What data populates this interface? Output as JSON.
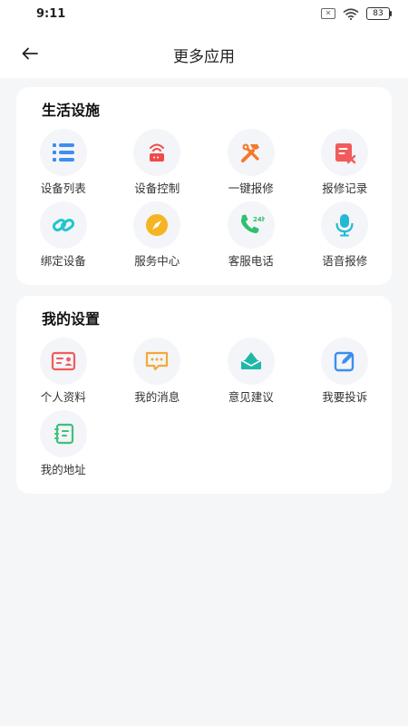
{
  "status": {
    "time": "9:11",
    "battery": "83"
  },
  "nav": {
    "title": "更多应用"
  },
  "sections": [
    {
      "title": "生活设施",
      "items": [
        {
          "label": "设备列表",
          "icon": "list-icon",
          "color": "#3d8ef0"
        },
        {
          "label": "设备控制",
          "icon": "router-icon",
          "color": "#f04a4a"
        },
        {
          "label": "一键报修",
          "icon": "tools-icon",
          "color": "#f5792a"
        },
        {
          "label": "报修记录",
          "icon": "record-icon",
          "color": "#f15b5b"
        },
        {
          "label": "绑定设备",
          "icon": "link-icon",
          "color": "#22c5d0"
        },
        {
          "label": "服务中心",
          "icon": "compass-icon",
          "color": "#f5b522"
        },
        {
          "label": "客服电话",
          "icon": "phone-24h-icon",
          "color": "#2fbf6f"
        },
        {
          "label": "语音报修",
          "icon": "microphone-icon",
          "color": "#23b9d4"
        }
      ]
    },
    {
      "title": "我的设置",
      "items": [
        {
          "label": "个人资料",
          "icon": "id-card-icon",
          "color": "#f15b5b"
        },
        {
          "label": "我的消息",
          "icon": "message-icon",
          "color": "#f5a83a"
        },
        {
          "label": "意见建议",
          "icon": "mail-icon",
          "color": "#1fb8a8"
        },
        {
          "label": "我要投诉",
          "icon": "edit-icon",
          "color": "#3d8ef0"
        },
        {
          "label": "我的地址",
          "icon": "notebook-icon",
          "color": "#3fc07a"
        }
      ]
    }
  ]
}
